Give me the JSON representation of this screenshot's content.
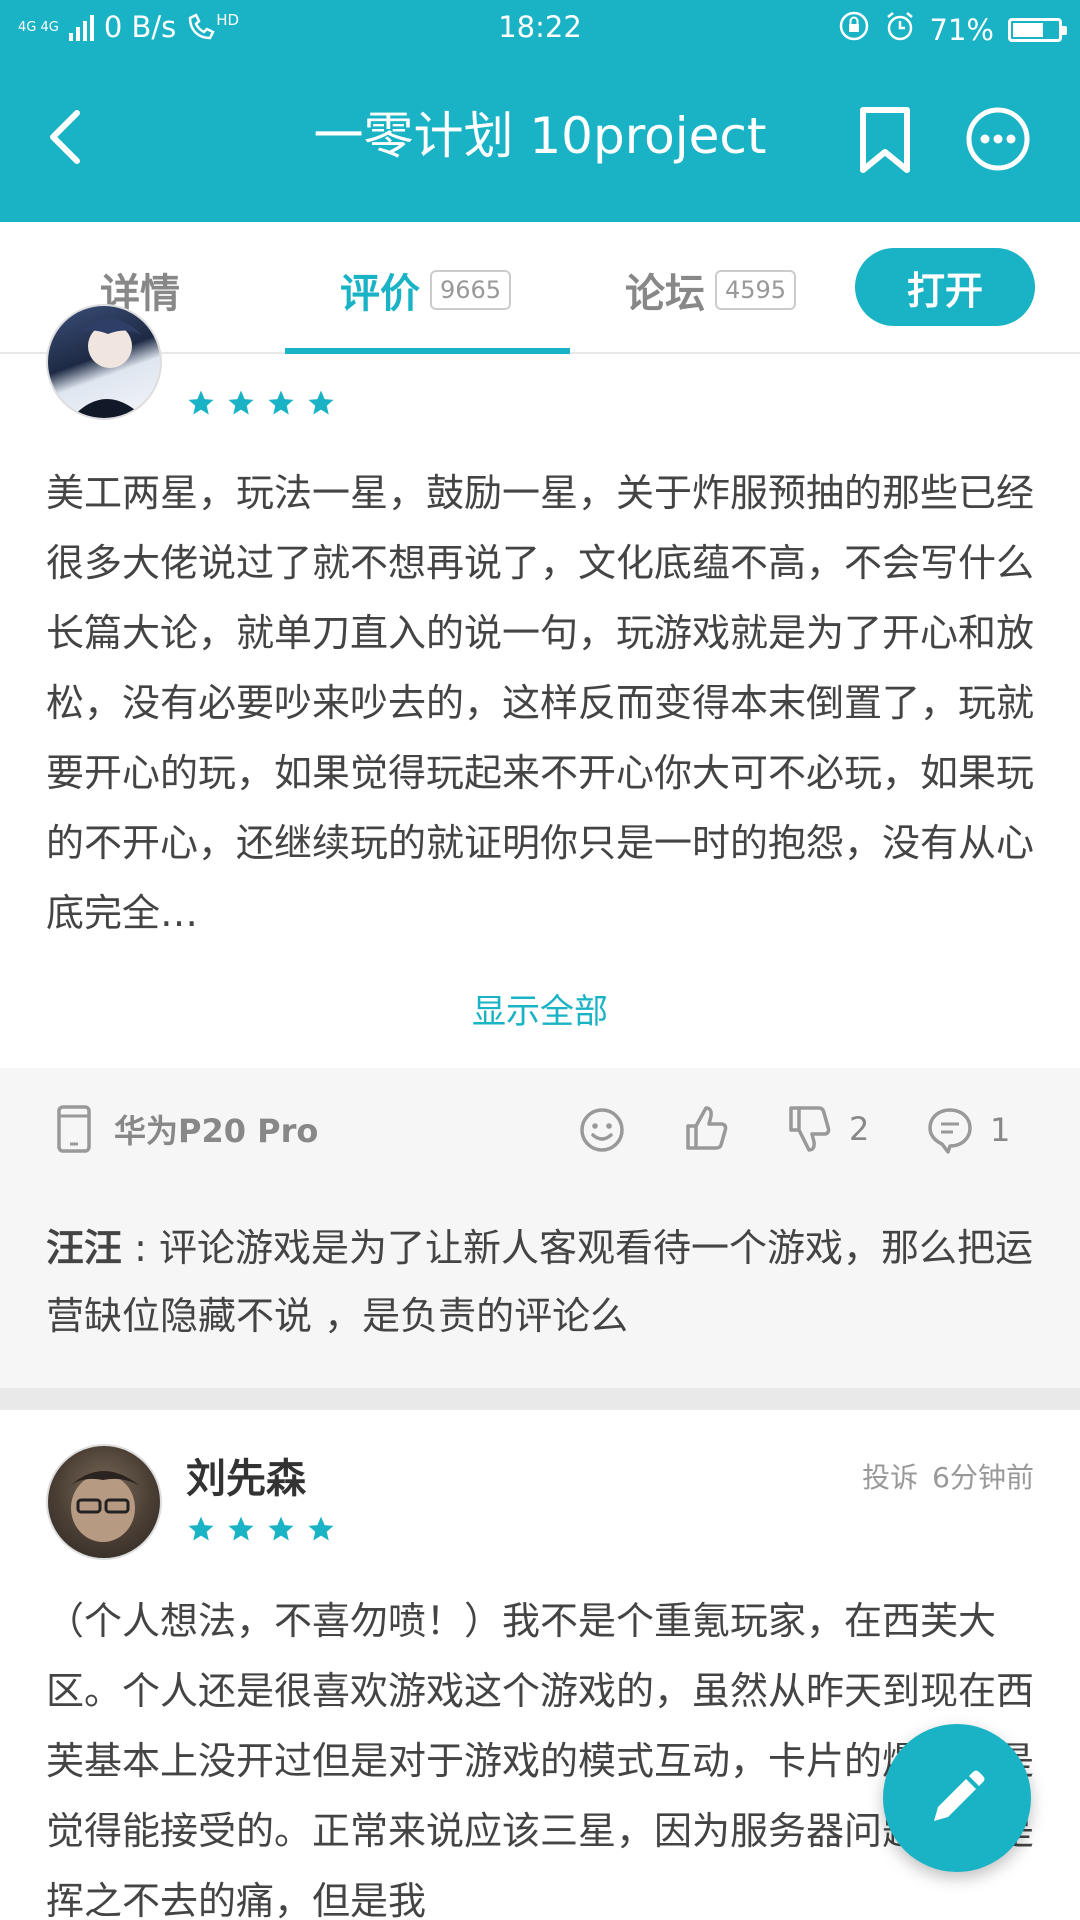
{
  "status_bar": {
    "network": "4G 4G",
    "speed": "0 B/s",
    "hd": "HD",
    "time": "18:22",
    "battery": "71%",
    "battery_level": 0.71
  },
  "header": {
    "title": "一零计划 10project",
    "back_icon": "chevron-left-icon",
    "bookmark_icon": "bookmark-icon",
    "more_icon": "more-icon"
  },
  "tabs": [
    {
      "label": "详情",
      "count": ""
    },
    {
      "label": "评价",
      "count": "9665",
      "active": true
    },
    {
      "label": "论坛",
      "count": "4595"
    }
  ],
  "open_button": "打开",
  "reviews": [
    {
      "rating": 4,
      "text": "美工两星，玩法一星，鼓励一星，关于炸服预抽的那些已经很多大佬说过了就不想再说了，文化底蕴不高，不会写什么长篇大论，就单刀直入的说一句，玩游戏就是为了开心和放松，没有必要吵来吵去的，这样反而变得本末倒置了，玩就要开心的玩，如果觉得玩起来不开心你大可不必玩，如果玩的不开心，还继续玩的就证明你只是一时的抱怨，没有从心底完全…",
      "show_all": "显示全部",
      "device": "华为P20 Pro",
      "dislikes": "2",
      "comments": "1",
      "reply_author": "汪汪",
      "reply_text": " : 评论游戏是为了让新人客观看待一个游戏，那么把运营缺位隐藏不说 ，是负责的评论么"
    },
    {
      "username": "刘先森",
      "report": "投诉",
      "time_ago": "6分钟前",
      "rating": 4,
      "text": "（个人想法，不喜勿喷！）我不是个重氪玩家，在西芙大区。个人还是很喜欢游戏这个游戏的，虽然从昨天到现在西芙基本上没开过但是对于游戏的模式互动，卡片的爆率还是觉得能接受的。正常来说应该三星，因为服务器问题始终是挥之不去的痛，但是我"
    }
  ],
  "colors": {
    "accent": "#1ab3c5",
    "text": "#444444",
    "muted": "#888888",
    "meta_bg": "#f6f6f6"
  }
}
